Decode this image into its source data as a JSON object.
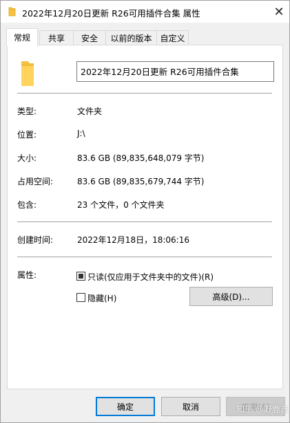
{
  "window": {
    "title": "2022年12月20日更新 R26可用插件合集 属性",
    "close_glyph": "✕"
  },
  "tabs": [
    {
      "label": "常规",
      "active": true
    },
    {
      "label": "共享",
      "active": false
    },
    {
      "label": "安全",
      "active": false
    },
    {
      "label": "以前的版本",
      "active": false
    },
    {
      "label": "自定义",
      "active": false
    }
  ],
  "general": {
    "folder_name": "2022年12月20日更新 R26可用插件合集",
    "rows": [
      {
        "label": "类型:",
        "value": "文件夹"
      },
      {
        "label": "位置:",
        "value": "J:\\"
      },
      {
        "label": "大小:",
        "value": "83.6 GB (89,835,648,079 字节)"
      },
      {
        "label": "占用空间:",
        "value": "83.6 GB (89,835,679,744 字节)"
      },
      {
        "label": "包含:",
        "value": "23 个文件，0 个文件夹"
      }
    ],
    "created_label": "创建时间:",
    "created_value": "2022年12月18日，18:06:16",
    "attributes_label": "属性:",
    "readonly_label": "只读(仅应用于文件夹中的文件)(R)",
    "hidden_label": "隐藏(H)",
    "advanced_button": "高级(D)..."
  },
  "footer": {
    "ok": "确定",
    "cancel": "取消",
    "apply": "应用(A)"
  },
  "watermark": "知乎 @野鹿志",
  "colors": {
    "folder": "#f5c242",
    "accent": "#0078d7"
  },
  "icons": {
    "title": "folder-icon",
    "large": "folder-icon"
  }
}
